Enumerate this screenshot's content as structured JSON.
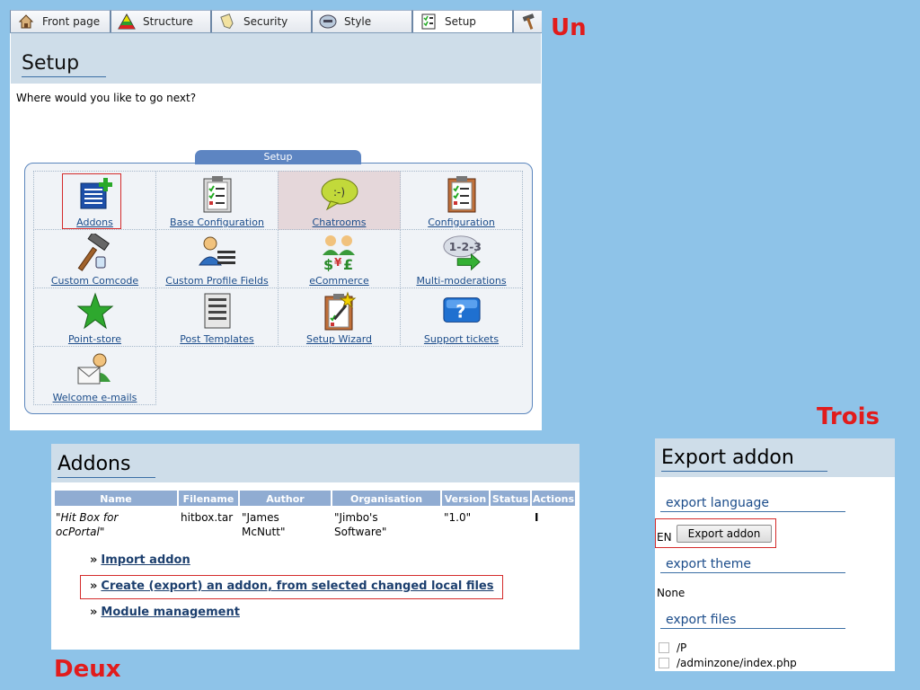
{
  "labels": {
    "un": "Un",
    "deux": "Deux",
    "trois": "Trois"
  },
  "panel_un": {
    "tabs": [
      {
        "label": "Front page",
        "icon": "house-icon"
      },
      {
        "label": "Structure",
        "icon": "pyramid-icon"
      },
      {
        "label": "Security",
        "icon": "tag-icon"
      },
      {
        "label": "Style",
        "icon": "palette-icon"
      },
      {
        "label": "Setup",
        "icon": "checklist-icon",
        "active": true
      }
    ],
    "title": "Setup",
    "intro": "Where would you like to go next?",
    "box_caption": "Setup",
    "items": [
      {
        "label": "Addons",
        "icon": "addons-icon",
        "selected": true
      },
      {
        "label": "Base Configuration",
        "icon": "clipboard-icon"
      },
      {
        "label": "Chatrooms",
        "icon": "chat-bubble-icon",
        "highlighted": true
      },
      {
        "label": "Configuration",
        "icon": "clipboard-icon"
      },
      {
        "label": "Custom Comcode",
        "icon": "hammer-icon"
      },
      {
        "label": "Custom Profile Fields",
        "icon": "profile-fields-icon"
      },
      {
        "label": "eCommerce",
        "icon": "ecommerce-icon"
      },
      {
        "label": "Multi-moderations",
        "icon": "multi-moderation-icon"
      },
      {
        "label": "Point-store",
        "icon": "star-icon"
      },
      {
        "label": "Post Templates",
        "icon": "document-icon"
      },
      {
        "label": "Setup Wizard",
        "icon": "wizard-icon"
      },
      {
        "label": "Support tickets",
        "icon": "help-icon"
      },
      {
        "label": "Welcome e-mails",
        "icon": "mail-person-icon"
      }
    ]
  },
  "panel_deux": {
    "title": "Addons",
    "columns": [
      "Name",
      "Filename",
      "Author",
      "Organisation",
      "Version",
      "Status",
      "Actions"
    ],
    "row": {
      "name_line1": "\"Hit Box for",
      "name_line2": "ocPortal\"",
      "filename": "hitbox.tar",
      "author_line1": "\"James",
      "author_line2": "McNutt\"",
      "org_line1": "\"Jimbo's",
      "org_line2": "Software\"",
      "version": "\"1.0\"",
      "status": "",
      "actions": "I"
    },
    "links": [
      {
        "arrow": "»",
        "label": "Import addon"
      },
      {
        "arrow": "»",
        "label": "Create (export) an addon, from selected changed local files",
        "selected": true
      },
      {
        "arrow": "»",
        "label": "Module management"
      }
    ]
  },
  "panel_trois": {
    "title": "Export addon",
    "sections": {
      "language": "export language",
      "theme": "export theme",
      "files": "export files"
    },
    "language_value": "EN",
    "export_button": "Export addon",
    "theme_value": "None",
    "files": [
      "/P",
      "/adminzone/index.php"
    ]
  }
}
